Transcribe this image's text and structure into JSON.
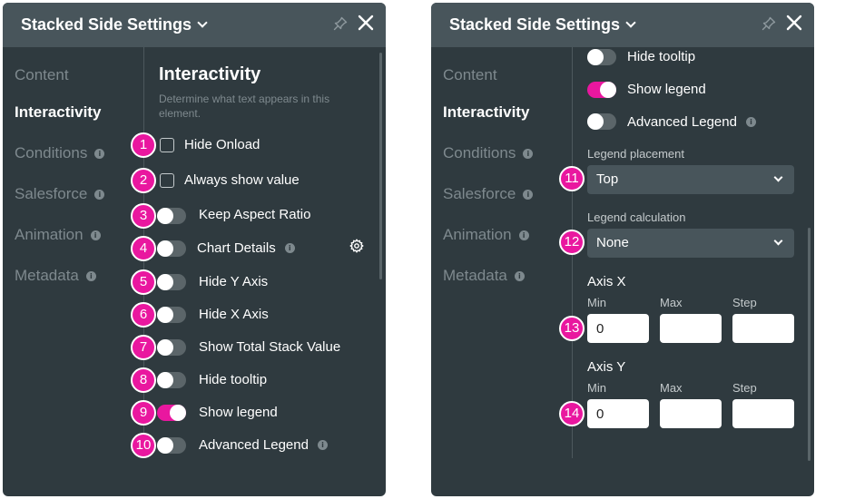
{
  "left_panel": {
    "header": {
      "title": "Stacked Side Settings"
    },
    "nav": [
      {
        "label": "Content",
        "active": false,
        "info": false
      },
      {
        "label": "Interactivity",
        "active": true,
        "info": false
      },
      {
        "label": "Conditions",
        "active": false,
        "info": true
      },
      {
        "label": "Salesforce",
        "active": false,
        "info": true
      },
      {
        "label": "Animation",
        "active": false,
        "info": true
      },
      {
        "label": "Metadata",
        "active": false,
        "info": true
      }
    ],
    "section": {
      "title": "Interactivity",
      "description": "Determine what text appears in this element."
    },
    "options": [
      {
        "badge": "1",
        "label": "Hide Onload",
        "control": "checkbox",
        "checked": false
      },
      {
        "badge": "2",
        "label": "Always show value",
        "control": "checkbox",
        "checked": false
      },
      {
        "badge": "3",
        "label": "Keep Aspect Ratio",
        "control": "toggle",
        "checked": false
      },
      {
        "badge": "4",
        "label": "Chart Details",
        "control": "toggle",
        "checked": false,
        "info": true,
        "gear": true
      },
      {
        "badge": "5",
        "label": "Hide Y Axis",
        "control": "toggle",
        "checked": false
      },
      {
        "badge": "6",
        "label": "Hide X Axis",
        "control": "toggle",
        "checked": false
      },
      {
        "badge": "7",
        "label": "Show Total Stack Value",
        "control": "toggle",
        "checked": false
      },
      {
        "badge": "8",
        "label": "Hide tooltip",
        "control": "toggle",
        "checked": false
      },
      {
        "badge": "9",
        "label": "Show legend",
        "control": "toggle",
        "checked": true
      },
      {
        "badge": "10",
        "label": "Advanced Legend",
        "control": "toggle",
        "checked": false,
        "info": true
      }
    ]
  },
  "right_panel": {
    "header": {
      "title": "Stacked Side Settings"
    },
    "nav": [
      {
        "label": "Content",
        "active": false,
        "info": false
      },
      {
        "label": "Interactivity",
        "active": true,
        "info": false
      },
      {
        "label": "Conditions",
        "active": false,
        "info": true
      },
      {
        "label": "Salesforce",
        "active": false,
        "info": true
      },
      {
        "label": "Animation",
        "active": false,
        "info": true
      },
      {
        "label": "Metadata",
        "active": false,
        "info": true
      }
    ],
    "options": [
      {
        "label": "Hide tooltip",
        "control": "toggle",
        "checked": false
      },
      {
        "label": "Show legend",
        "control": "toggle",
        "checked": true
      },
      {
        "label": "Advanced Legend",
        "control": "toggle",
        "checked": false,
        "info": true
      }
    ],
    "legend_placement": {
      "badge": "11",
      "label": "Legend placement",
      "value": "Top"
    },
    "legend_calculation": {
      "badge": "12",
      "label": "Legend calculation",
      "value": "None"
    },
    "axis_x": {
      "badge": "13",
      "title": "Axis X",
      "min_label": "Min",
      "max_label": "Max",
      "step_label": "Step",
      "min_value": "0",
      "max_value": "",
      "step_value": ""
    },
    "axis_y": {
      "badge": "14",
      "title": "Axis Y",
      "min_label": "Min",
      "max_label": "Max",
      "step_label": "Step",
      "min_value": "0",
      "max_value": "",
      "step_value": ""
    }
  },
  "colors": {
    "panel_bg": "#2f3a3f",
    "header_bg": "#48555b",
    "accent": "#e9179f",
    "muted_text": "#7e898e"
  },
  "icons": {
    "title_chevron": "chevron-down-icon",
    "pin": "pin-icon",
    "close": "close-icon",
    "info": "info-icon",
    "gear": "gear-icon"
  }
}
